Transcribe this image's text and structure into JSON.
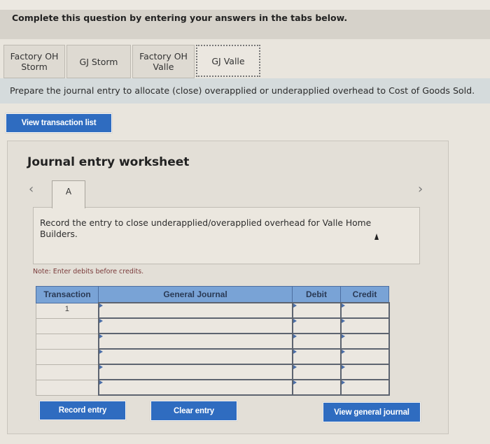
{
  "instruction": "Complete this question by entering your answers in the tabs below.",
  "tabs": [
    {
      "label": "Factory OH\nStorm",
      "active": false
    },
    {
      "label": "GJ Storm",
      "active": false
    },
    {
      "label": "Factory OH\nValle",
      "active": false
    },
    {
      "label": "GJ Valle",
      "active": true
    }
  ],
  "prompt": "Prepare the journal entry to allocate (close) overapplied or underapplied overhead to Cost of Goods Sold.",
  "buttons": {
    "view_transaction_list": "View transaction list",
    "record_entry": "Record entry",
    "clear_entry": "Clear entry",
    "view_general_journal": "View general journal"
  },
  "worksheet": {
    "title": "Journal entry worksheet",
    "prev_icon": "‹",
    "next_icon": "›",
    "current_tab": "A",
    "description": "Record the entry to close underapplied/overapplied overhead for Valle Home Builders.",
    "note": "Note: Enter debits before credits."
  },
  "journal": {
    "headers": [
      "Transaction",
      "General Journal",
      "Debit",
      "Credit"
    ],
    "rows": [
      {
        "transaction": "1",
        "account": "",
        "debit": "",
        "credit": ""
      },
      {
        "transaction": "",
        "account": "",
        "debit": "",
        "credit": ""
      },
      {
        "transaction": "",
        "account": "",
        "debit": "",
        "credit": ""
      },
      {
        "transaction": "",
        "account": "",
        "debit": "",
        "credit": ""
      },
      {
        "transaction": "",
        "account": "",
        "debit": "",
        "credit": ""
      },
      {
        "transaction": "",
        "account": "",
        "debit": "",
        "credit": ""
      }
    ]
  },
  "colors": {
    "button_blue": "#2f6cc0",
    "table_header_blue": "#79a3d6",
    "note_red": "#7a3a3a"
  }
}
